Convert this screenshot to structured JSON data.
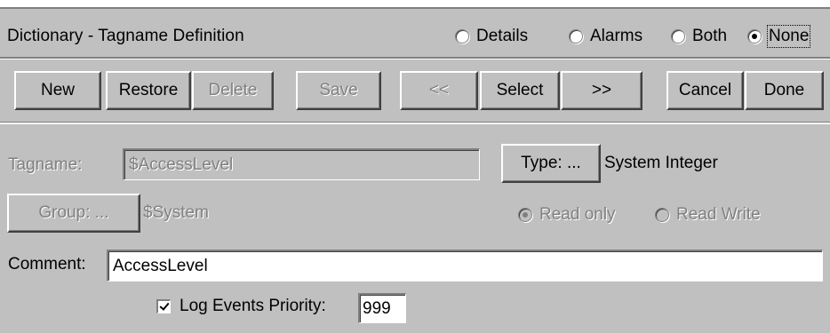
{
  "window": {
    "title": "Dictionary - Tagname Definition"
  },
  "view_options": [
    {
      "label": "Details",
      "selected": false
    },
    {
      "label": "Alarms",
      "selected": false
    },
    {
      "label": "Both",
      "selected": false
    },
    {
      "label": "None",
      "selected": true
    }
  ],
  "toolbar": {
    "new": "New",
    "restore": "Restore",
    "delete": "Delete",
    "save": "Save",
    "prev": "<<",
    "select": "Select",
    "next": ">>",
    "cancel": "Cancel",
    "done": "Done"
  },
  "form": {
    "tagname_label": "Tagname:",
    "tagname_value": "$AccessLevel",
    "type_button": "Type: ...",
    "type_value": "System Integer",
    "group_button": "Group: ...",
    "group_value": "$System",
    "read_only_label": "Read only",
    "read_write_label": "Read Write",
    "access_selected": "Read only",
    "comment_label": "Comment:",
    "comment_value": "AccessLevel",
    "log_events_label": "Log Events Priority:",
    "log_events_checked": true,
    "priority_value": "999"
  }
}
